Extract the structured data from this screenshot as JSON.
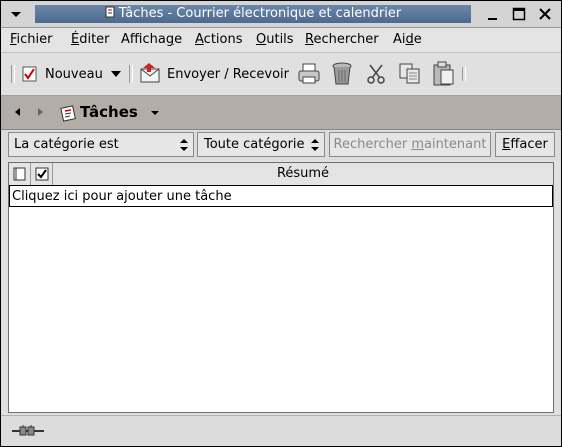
{
  "window": {
    "title": "Tâches - Courrier électronique et calendrier"
  },
  "menubar": {
    "items": [
      {
        "pre": "",
        "key": "F",
        "post": "ichier"
      },
      {
        "pre": "",
        "key": "É",
        "post": "diter"
      },
      {
        "pre": "Afficha",
        "key": "g",
        "post": "e"
      },
      {
        "pre": "",
        "key": "A",
        "post": "ctions"
      },
      {
        "pre": "",
        "key": "O",
        "post": "utils"
      },
      {
        "pre": "",
        "key": "R",
        "post": "echercher"
      },
      {
        "pre": "Ai",
        "key": "d",
        "post": "e"
      }
    ]
  },
  "toolbar": {
    "new_label": "Nouveau",
    "send_receive_label": "Envoyer / Recevoir"
  },
  "navbar": {
    "folder_title": "Tâches"
  },
  "search": {
    "condition_value": "La catégorie est",
    "category_value": "Toute catégorie",
    "search_now_pre": "Rechercher ",
    "search_now_key": "m",
    "search_now_post": "aintenant",
    "clear_key": "E",
    "clear_post": "ffacer"
  },
  "table": {
    "summary_header": "Résumé",
    "add_task_prompt": "Cliquez ici pour ajouter une tâche"
  },
  "colors": {
    "title_bar": "#5a7699",
    "nav_bar": "#b2aea7"
  }
}
